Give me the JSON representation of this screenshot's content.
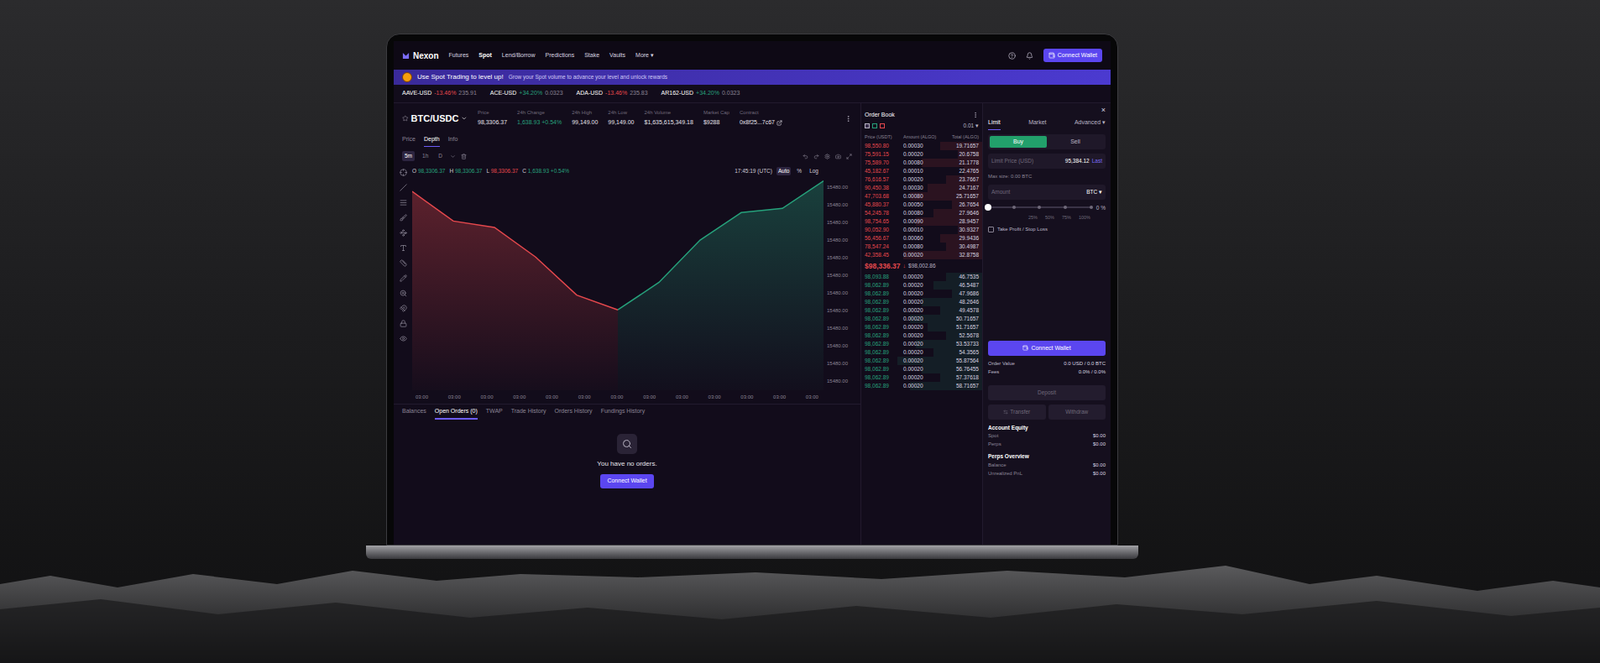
{
  "nav": {
    "logo": "Nexon",
    "items": [
      {
        "label": "Futures",
        "selected": false
      },
      {
        "label": "Spot",
        "selected": true
      },
      {
        "label": "Lend/Borrow",
        "selected": false
      },
      {
        "label": "Predictions",
        "selected": false
      },
      {
        "label": "Stake",
        "selected": false
      },
      {
        "label": "Vaults",
        "selected": false
      },
      {
        "label": "More ▾",
        "selected": false
      }
    ],
    "connect": "Connect Wallet"
  },
  "banner": {
    "title": "Use Spot Trading to level up!",
    "text": "Grow your Spot volume to advance your level and unlock rewards"
  },
  "ticker": [
    {
      "symbol": "AAVE-USD",
      "change": "-13.46%",
      "price": "235.91",
      "up": false
    },
    {
      "symbol": "ACE-USD",
      "change": "+34.20%",
      "price": "0.0323",
      "up": true
    },
    {
      "symbol": "ADA-USD",
      "change": "-13.46%",
      "price": "235.83",
      "up": false
    },
    {
      "symbol": "AR162-USD",
      "change": "+34.20%",
      "price": "0.0323",
      "up": true
    }
  ],
  "pair": {
    "name": "BTC/USDC",
    "stats": [
      {
        "label": "Price",
        "value": "98,3306.37",
        "up": false
      },
      {
        "label": "24h Change",
        "value": "1,638.93 +0.54%",
        "up": true
      },
      {
        "label": "24h High",
        "value": "99,149.00",
        "up": false
      },
      {
        "label": "24h Low",
        "value": "99,149.00",
        "up": false
      },
      {
        "label": "24h Volume",
        "value": "$1,635,615,349.18",
        "up": false
      },
      {
        "label": "Market Cap",
        "value": "$9288",
        "up": false
      },
      {
        "label": "Contract",
        "value": "0x8f25...7c67",
        "up": false
      }
    ]
  },
  "view_tabs": [
    {
      "label": "Price",
      "selected": false
    },
    {
      "label": "Depth",
      "selected": true
    },
    {
      "label": "Info",
      "selected": false
    }
  ],
  "intervals": [
    {
      "label": "5m",
      "selected": true
    },
    {
      "label": "1h",
      "selected": false
    },
    {
      "label": "D",
      "selected": false
    }
  ],
  "ohlc": [
    {
      "key": "O",
      "value": "98,3306.37",
      "color": "#26a17b"
    },
    {
      "key": "H",
      "value": "98,3306.37",
      "color": "#26a17b"
    },
    {
      "key": "L",
      "value": "98,3306.37",
      "color": "#e5484d"
    },
    {
      "key": "C",
      "value": "1,638.93 +0.54%",
      "color": "#26a17b"
    }
  ],
  "chart_controls": {
    "time": "17:45:19 (UTC)",
    "options": [
      {
        "label": "Auto",
        "selected": true
      },
      {
        "label": "%",
        "selected": false
      },
      {
        "label": "Log",
        "selected": false
      }
    ]
  },
  "chart": {
    "y_ticks": [
      "15480.00",
      "15480.00",
      "15480.00",
      "15480.00",
      "15480.00",
      "15480.00",
      "15480.00",
      "15480.00",
      "15480.00",
      "15480.00",
      "15480.00",
      "15480.00"
    ],
    "x_ticks": [
      "03:00",
      "03:00",
      "03:00",
      "03:00",
      "03:00",
      "03:00",
      "03:00",
      "03:00",
      "03:00",
      "03:00",
      "03:00",
      "03:00",
      "03:00"
    ],
    "max": 10,
    "series": [
      {
        "name": "bids",
        "color": "#e5484d",
        "values": [
          9.4,
          8.0,
          7.7,
          6.3,
          4.5,
          3.8
        ]
      },
      {
        "name": "asks",
        "color": "#26a17b",
        "values": [
          3.8,
          5.1,
          7.1,
          8.4,
          8.6,
          9.9
        ]
      }
    ]
  },
  "bottom_tabs": [
    {
      "label": "Balances",
      "selected": false
    },
    {
      "label": "Open Orders (0)",
      "selected": true
    },
    {
      "label": "TWAP",
      "selected": false
    },
    {
      "label": "Trade History",
      "selected": false
    },
    {
      "label": "Orders History",
      "selected": false
    },
    {
      "label": "Fundings History",
      "selected": false
    }
  ],
  "empty": {
    "text": "You have no orders.",
    "button": "Connect Wallet"
  },
  "order_book": {
    "title": "Order Book",
    "tick": "0.01 ▾",
    "columns": [
      "Price (USDT)",
      "Amount (ALGO)",
      "Total (ALGO)"
    ],
    "asks": [
      {
        "price": "98,550.80",
        "amount": "0.00030",
        "total": "19.71657",
        "level": 0.35
      },
      {
        "price": "75,591.15",
        "amount": "0.00020",
        "total": "20.6758",
        "level": 0.2
      },
      {
        "price": "75,589.70",
        "amount": "0.00080",
        "total": "21.1778",
        "level": 0.5
      },
      {
        "price": "45,182.67",
        "amount": "0.00010",
        "total": "22.4765",
        "level": 0.15
      },
      {
        "price": "76,616.57",
        "amount": "0.00020",
        "total": "23.7667",
        "level": 0.3
      },
      {
        "price": "90,450.38",
        "amount": "0.00030",
        "total": "24.7167",
        "level": 0.45
      },
      {
        "price": "47,703.68",
        "amount": "0.00080",
        "total": "25.71657",
        "level": 0.6
      },
      {
        "price": "45,880.37",
        "amount": "0.00050",
        "total": "26.7654",
        "level": 0.25
      },
      {
        "price": "54,245.78",
        "amount": "0.00080",
        "total": "27.9646",
        "level": 0.4
      },
      {
        "price": "98,754.65",
        "amount": "0.00090",
        "total": "28.9457",
        "level": 0.55
      },
      {
        "price": "90,052.90",
        "amount": "0.00010",
        "total": "30.9327",
        "level": 0.2
      },
      {
        "price": "56,456.67",
        "amount": "0.00060",
        "total": "29.9436",
        "level": 0.35
      },
      {
        "price": "78,547.24",
        "amount": "0.00080",
        "total": "30.4987",
        "level": 0.3
      },
      {
        "price": "42,358.45",
        "amount": "0.00020",
        "total": "32.8758",
        "level": 0.65
      }
    ],
    "mid": {
      "price": "$98,336.37",
      "arrow": "↓",
      "mark": "$98,002.86"
    },
    "bids": [
      {
        "price": "98,093.88",
        "amount": "0.00020",
        "total": "46.7535",
        "level": 0.3
      },
      {
        "price": "98,062.89",
        "amount": "0.00020",
        "total": "46.5487",
        "level": 0.4
      },
      {
        "price": "98,062.89",
        "amount": "0.00020",
        "total": "47.9686",
        "level": 0.25
      },
      {
        "price": "98,062.89",
        "amount": "0.00020",
        "total": "48.2646",
        "level": 0.5
      },
      {
        "price": "98,062.89",
        "amount": "0.00020",
        "total": "49.4578",
        "level": 0.35
      },
      {
        "price": "98,062.89",
        "amount": "0.00020",
        "total": "50.71657",
        "level": 0.6
      },
      {
        "price": "98,062.89",
        "amount": "0.00020",
        "total": "51.71657",
        "level": 0.45
      },
      {
        "price": "98,062.89",
        "amount": "0.00020",
        "total": "52.5678",
        "level": 0.3
      },
      {
        "price": "98,062.89",
        "amount": "0.00020",
        "total": "53.53733",
        "level": 0.55
      },
      {
        "price": "98,062.89",
        "amount": "0.00020",
        "total": "54.3565",
        "level": 0.4
      },
      {
        "price": "98,062.89",
        "amount": "0.00020",
        "total": "55.87564",
        "level": 0.7
      },
      {
        "price": "98,062.89",
        "amount": "0.00020",
        "total": "56.76455",
        "level": 0.5
      },
      {
        "price": "98,062.89",
        "amount": "0.00020",
        "total": "57.37618",
        "level": 0.35
      },
      {
        "price": "98,062.89",
        "amount": "0.00020",
        "total": "58.71657",
        "level": 0.6
      }
    ]
  },
  "order_form": {
    "close": "×",
    "order_types": [
      {
        "label": "Limit",
        "selected": true
      },
      {
        "label": "Market",
        "selected": false
      },
      {
        "label": "Advanced ▾",
        "selected": false
      }
    ],
    "sides": [
      {
        "label": "Buy",
        "selected": true
      },
      {
        "label": "Sell",
        "selected": false
      }
    ],
    "limit_price": {
      "label": "Limit Price (USD)",
      "value": "95,384.12",
      "action": "Last"
    },
    "max_size": "Max size: 0.00 BTC",
    "amount": {
      "label": "Amount",
      "unit": "BTC ▾"
    },
    "slider": {
      "level": 0,
      "marks": [
        "25%",
        "50%",
        "75%",
        "100%"
      ],
      "reading": "0 %"
    },
    "tpsl": {
      "label": "Take Profit / Stop Loss",
      "checked": false
    },
    "connect": "Connect Wallet",
    "summary": [
      {
        "label": "Order Value",
        "value": "0.0 USD / 0.0 BTC"
      },
      {
        "label": "Fees",
        "value": "0.0% / 0.0%"
      }
    ],
    "deposit": "Deposit",
    "transfer": "Transfer",
    "withdraw": "Withdraw",
    "sections": [
      {
        "title": "Account Equity",
        "rows": [
          {
            "label": "Spot",
            "value": "$0.00"
          },
          {
            "label": "Perps",
            "value": "$0.00"
          }
        ]
      },
      {
        "title": "Perps Overview",
        "rows": [
          {
            "label": "Balance",
            "value": "$0.00"
          },
          {
            "label": "Unrealized PnL",
            "value": "$0.00"
          }
        ]
      }
    ]
  }
}
